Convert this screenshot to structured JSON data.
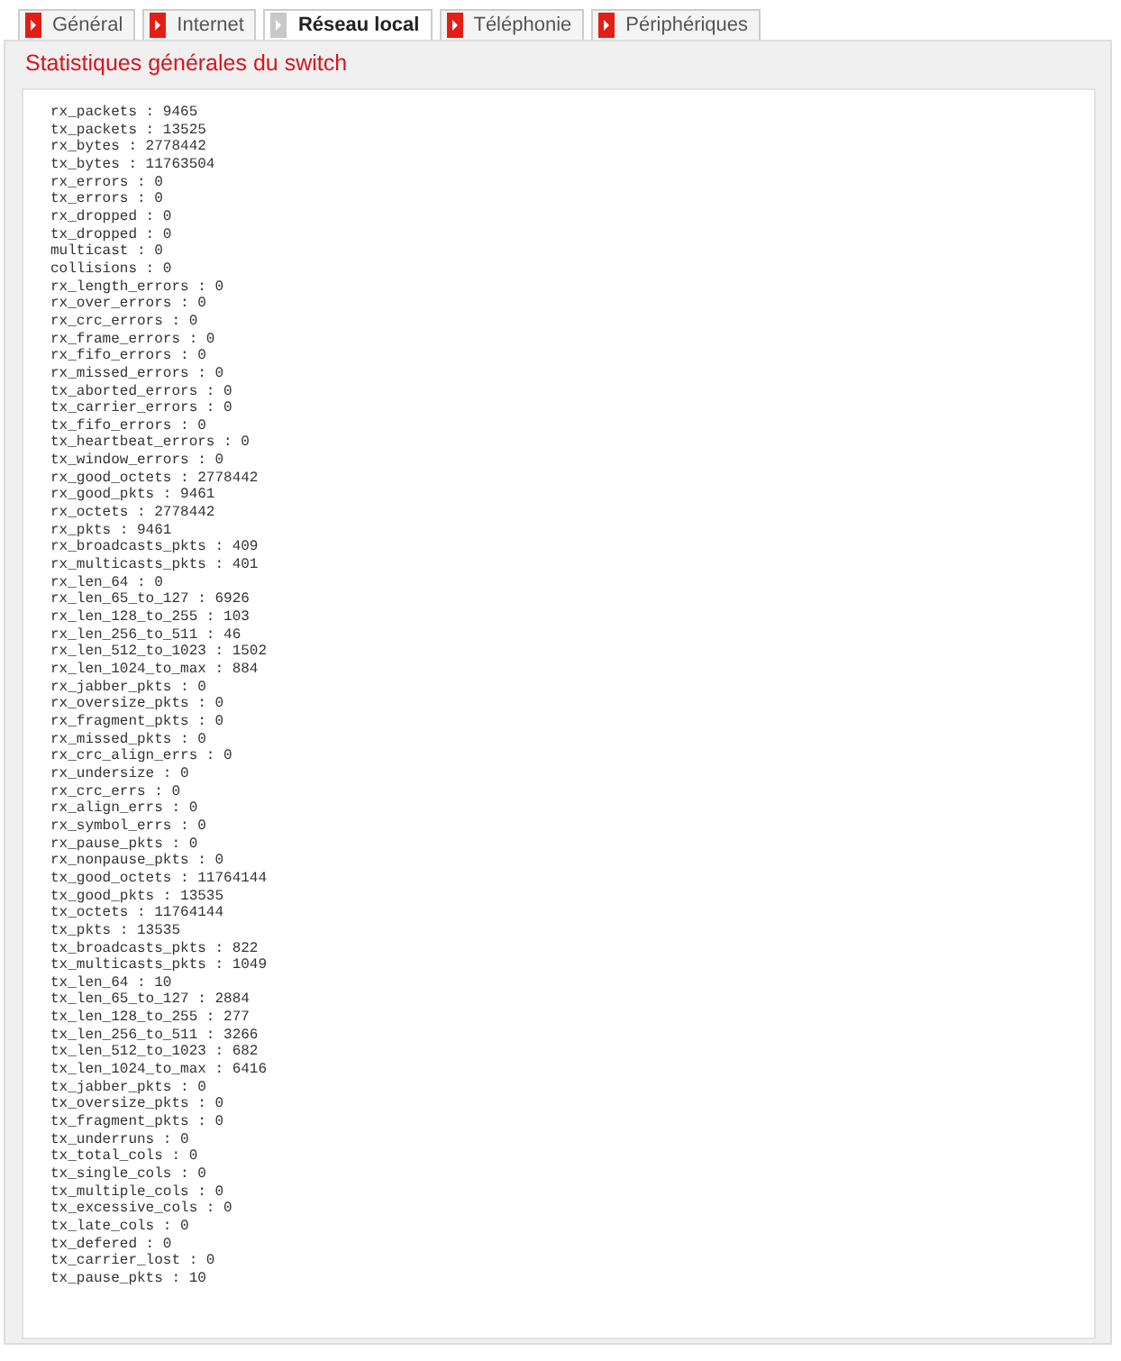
{
  "tabs": [
    {
      "label": "Général",
      "selected": false
    },
    {
      "label": "Internet",
      "selected": false
    },
    {
      "label": "Réseau local",
      "selected": true
    },
    {
      "label": "Téléphonie",
      "selected": false
    },
    {
      "label": "Périphériques",
      "selected": false
    }
  ],
  "panel": {
    "title": "Statistiques générales du switch",
    "lines": [
      "rx_packets : 9465",
      "tx_packets : 13525",
      "rx_bytes : 2778442",
      "tx_bytes : 11763504",
      "rx_errors : 0",
      "tx_errors : 0",
      "rx_dropped : 0",
      "tx_dropped : 0",
      "multicast : 0",
      "collisions : 0",
      "rx_length_errors : 0",
      "rx_over_errors : 0",
      "rx_crc_errors : 0",
      "rx_frame_errors : 0",
      "rx_fifo_errors : 0",
      "rx_missed_errors : 0",
      "tx_aborted_errors : 0",
      "tx_carrier_errors : 0",
      "tx_fifo_errors : 0",
      "tx_heartbeat_errors : 0",
      "tx_window_errors : 0",
      "rx_good_octets : 2778442",
      "rx_good_pkts : 9461",
      "rx_octets : 2778442",
      "rx_pkts : 9461",
      "rx_broadcasts_pkts : 409",
      "rx_multicasts_pkts : 401",
      "rx_len_64 : 0",
      "rx_len_65_to_127 : 6926",
      "rx_len_128_to_255 : 103",
      "rx_len_256_to_511 : 46",
      "rx_len_512_to_1023 : 1502",
      "rx_len_1024_to_max : 884",
      "rx_jabber_pkts : 0",
      "rx_oversize_pkts : 0",
      "rx_fragment_pkts : 0",
      "rx_missed_pkts : 0",
      "rx_crc_align_errs : 0",
      "rx_undersize : 0",
      "rx_crc_errs : 0",
      "rx_align_errs : 0",
      "rx_symbol_errs : 0",
      "rx_pause_pkts : 0",
      "rx_nonpause_pkts : 0",
      "tx_good_octets : 11764144",
      "tx_good_pkts : 13535",
      "tx_octets : 11764144",
      "tx_pkts : 13535",
      "tx_broadcasts_pkts : 822",
      "tx_multicasts_pkts : 1049",
      "tx_len_64 : 10",
      "tx_len_65_to_127 : 2884",
      "tx_len_128_to_255 : 277",
      "tx_len_256_to_511 : 3266",
      "tx_len_512_to_1023 : 682",
      "tx_len_1024_to_max : 6416",
      "tx_jabber_pkts : 0",
      "tx_oversize_pkts : 0",
      "tx_fragment_pkts : 0",
      "tx_underruns : 0",
      "tx_total_cols : 0",
      "tx_single_cols : 0",
      "tx_multiple_cols : 0",
      "tx_excessive_cols : 0",
      "tx_late_cols : 0",
      "tx_defered : 0",
      "tx_carrier_lost : 0",
      "tx_pause_pkts : 10"
    ]
  }
}
